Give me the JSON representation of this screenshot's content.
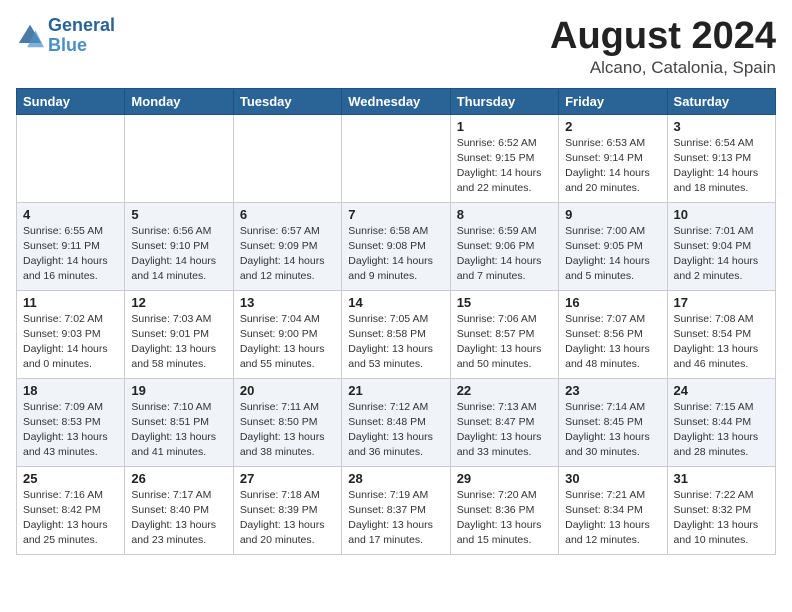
{
  "header": {
    "logo_general": "General",
    "logo_blue": "Blue",
    "month_year": "August 2024",
    "location": "Alcano, Catalonia, Spain"
  },
  "weekdays": [
    "Sunday",
    "Monday",
    "Tuesday",
    "Wednesday",
    "Thursday",
    "Friday",
    "Saturday"
  ],
  "weeks": [
    [
      {
        "day": "",
        "info": ""
      },
      {
        "day": "",
        "info": ""
      },
      {
        "day": "",
        "info": ""
      },
      {
        "day": "",
        "info": ""
      },
      {
        "day": "1",
        "info": "Sunrise: 6:52 AM\nSunset: 9:15 PM\nDaylight: 14 hours\nand 22 minutes."
      },
      {
        "day": "2",
        "info": "Sunrise: 6:53 AM\nSunset: 9:14 PM\nDaylight: 14 hours\nand 20 minutes."
      },
      {
        "day": "3",
        "info": "Sunrise: 6:54 AM\nSunset: 9:13 PM\nDaylight: 14 hours\nand 18 minutes."
      }
    ],
    [
      {
        "day": "4",
        "info": "Sunrise: 6:55 AM\nSunset: 9:11 PM\nDaylight: 14 hours\nand 16 minutes."
      },
      {
        "day": "5",
        "info": "Sunrise: 6:56 AM\nSunset: 9:10 PM\nDaylight: 14 hours\nand 14 minutes."
      },
      {
        "day": "6",
        "info": "Sunrise: 6:57 AM\nSunset: 9:09 PM\nDaylight: 14 hours\nand 12 minutes."
      },
      {
        "day": "7",
        "info": "Sunrise: 6:58 AM\nSunset: 9:08 PM\nDaylight: 14 hours\nand 9 minutes."
      },
      {
        "day": "8",
        "info": "Sunrise: 6:59 AM\nSunset: 9:06 PM\nDaylight: 14 hours\nand 7 minutes."
      },
      {
        "day": "9",
        "info": "Sunrise: 7:00 AM\nSunset: 9:05 PM\nDaylight: 14 hours\nand 5 minutes."
      },
      {
        "day": "10",
        "info": "Sunrise: 7:01 AM\nSunset: 9:04 PM\nDaylight: 14 hours\nand 2 minutes."
      }
    ],
    [
      {
        "day": "11",
        "info": "Sunrise: 7:02 AM\nSunset: 9:03 PM\nDaylight: 14 hours\nand 0 minutes."
      },
      {
        "day": "12",
        "info": "Sunrise: 7:03 AM\nSunset: 9:01 PM\nDaylight: 13 hours\nand 58 minutes."
      },
      {
        "day": "13",
        "info": "Sunrise: 7:04 AM\nSunset: 9:00 PM\nDaylight: 13 hours\nand 55 minutes."
      },
      {
        "day": "14",
        "info": "Sunrise: 7:05 AM\nSunset: 8:58 PM\nDaylight: 13 hours\nand 53 minutes."
      },
      {
        "day": "15",
        "info": "Sunrise: 7:06 AM\nSunset: 8:57 PM\nDaylight: 13 hours\nand 50 minutes."
      },
      {
        "day": "16",
        "info": "Sunrise: 7:07 AM\nSunset: 8:56 PM\nDaylight: 13 hours\nand 48 minutes."
      },
      {
        "day": "17",
        "info": "Sunrise: 7:08 AM\nSunset: 8:54 PM\nDaylight: 13 hours\nand 46 minutes."
      }
    ],
    [
      {
        "day": "18",
        "info": "Sunrise: 7:09 AM\nSunset: 8:53 PM\nDaylight: 13 hours\nand 43 minutes."
      },
      {
        "day": "19",
        "info": "Sunrise: 7:10 AM\nSunset: 8:51 PM\nDaylight: 13 hours\nand 41 minutes."
      },
      {
        "day": "20",
        "info": "Sunrise: 7:11 AM\nSunset: 8:50 PM\nDaylight: 13 hours\nand 38 minutes."
      },
      {
        "day": "21",
        "info": "Sunrise: 7:12 AM\nSunset: 8:48 PM\nDaylight: 13 hours\nand 36 minutes."
      },
      {
        "day": "22",
        "info": "Sunrise: 7:13 AM\nSunset: 8:47 PM\nDaylight: 13 hours\nand 33 minutes."
      },
      {
        "day": "23",
        "info": "Sunrise: 7:14 AM\nSunset: 8:45 PM\nDaylight: 13 hours\nand 30 minutes."
      },
      {
        "day": "24",
        "info": "Sunrise: 7:15 AM\nSunset: 8:44 PM\nDaylight: 13 hours\nand 28 minutes."
      }
    ],
    [
      {
        "day": "25",
        "info": "Sunrise: 7:16 AM\nSunset: 8:42 PM\nDaylight: 13 hours\nand 25 minutes."
      },
      {
        "day": "26",
        "info": "Sunrise: 7:17 AM\nSunset: 8:40 PM\nDaylight: 13 hours\nand 23 minutes."
      },
      {
        "day": "27",
        "info": "Sunrise: 7:18 AM\nSunset: 8:39 PM\nDaylight: 13 hours\nand 20 minutes."
      },
      {
        "day": "28",
        "info": "Sunrise: 7:19 AM\nSunset: 8:37 PM\nDaylight: 13 hours\nand 17 minutes."
      },
      {
        "day": "29",
        "info": "Sunrise: 7:20 AM\nSunset: 8:36 PM\nDaylight: 13 hours\nand 15 minutes."
      },
      {
        "day": "30",
        "info": "Sunrise: 7:21 AM\nSunset: 8:34 PM\nDaylight: 13 hours\nand 12 minutes."
      },
      {
        "day": "31",
        "info": "Sunrise: 7:22 AM\nSunset: 8:32 PM\nDaylight: 13 hours\nand 10 minutes."
      }
    ]
  ]
}
